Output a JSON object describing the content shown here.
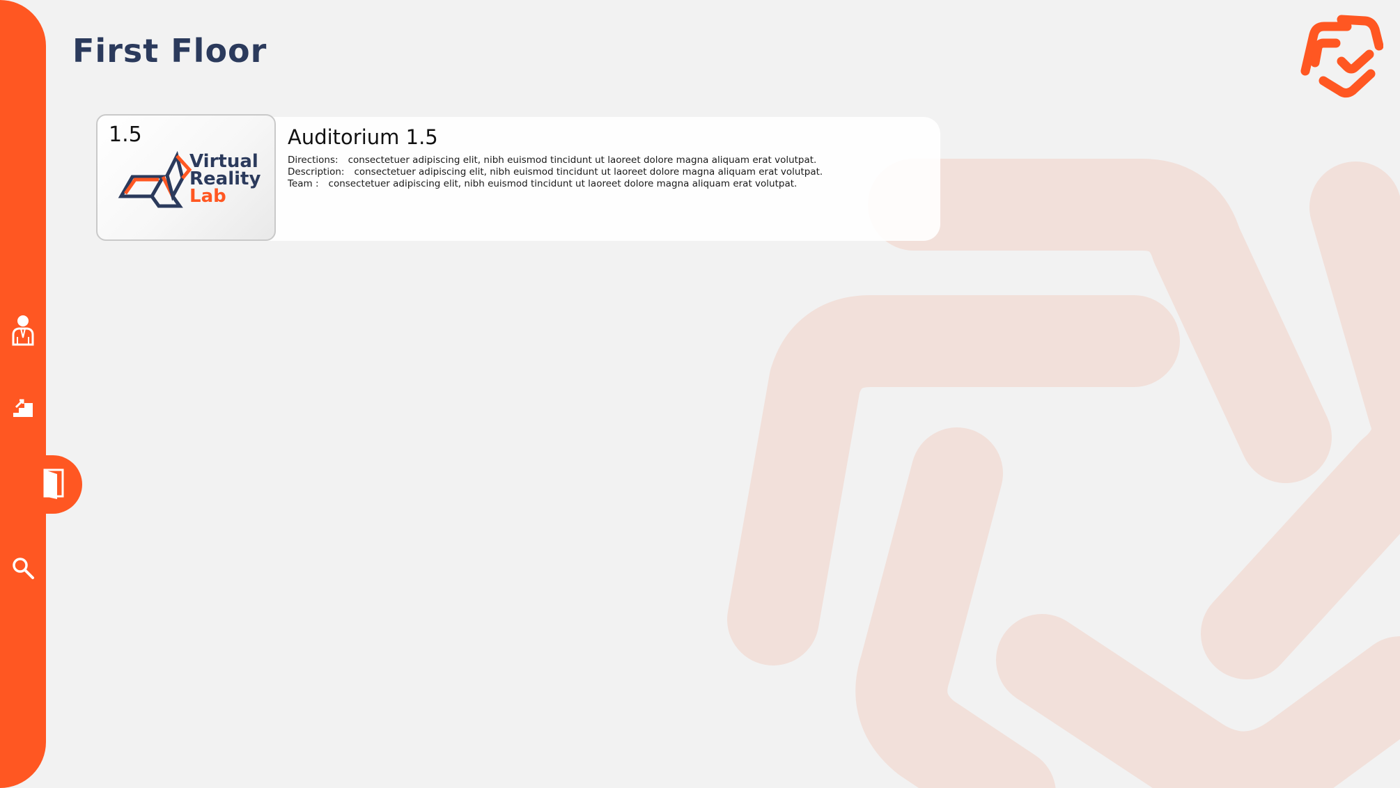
{
  "page": {
    "title": "First Floor"
  },
  "colors": {
    "accent": "#ff5722",
    "title_text": "#2b3a5c",
    "background": "#f2f2f2",
    "watermark": "#f2e0da"
  },
  "sidebar": {
    "items": [
      {
        "name": "staff",
        "icon": "person-icon",
        "active": false
      },
      {
        "name": "floors",
        "icon": "stairs-icon",
        "active": false
      },
      {
        "name": "rooms",
        "icon": "door-icon",
        "active": true
      },
      {
        "name": "search",
        "icon": "search-icon",
        "active": false
      }
    ]
  },
  "room": {
    "number": "1.5",
    "name": "Auditorium 1.5",
    "logo": {
      "line1": "Virtual",
      "line2": "Reality",
      "line3": "Lab"
    },
    "details": [
      {
        "label": "Directions:",
        "value": "consectetuer adipiscing elit,  nibh euismod tincidunt ut laoreet dolore magna aliquam erat volutpat."
      },
      {
        "label": "Description:",
        "value": "consectetuer adipiscing elit,  nibh euismod tincidunt ut laoreet dolore magna aliquam erat volutpat."
      },
      {
        "label": "Team :",
        "value": "consectetuer adipiscing elit,  nibh euismod tincidunt ut laoreet dolore magna aliquam erat volutpat."
      }
    ]
  }
}
